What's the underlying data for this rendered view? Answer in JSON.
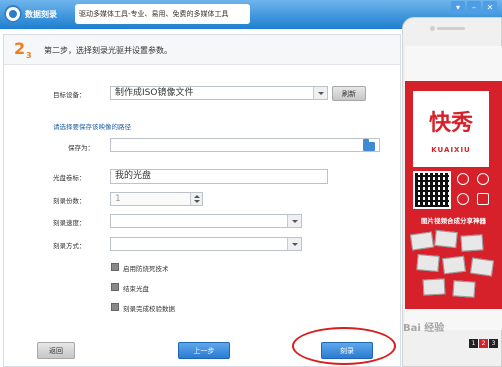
{
  "app": {
    "title": "数据刻录",
    "slogan": "驱动多媒体工具-专业、易用、免费的多媒体工具"
  },
  "window_controls": [
    "▾",
    "–",
    "✕"
  ],
  "step": {
    "number": "2",
    "total": "3",
    "title": "第二步，选择刻录光驱并设置参数。"
  },
  "form": {
    "target_device": {
      "label": "目标设备：",
      "value": "制作成ISO镜像文件",
      "refresh_label": "刷新"
    },
    "save_path_hint": "请选择要保存该映像的路径",
    "save_as": {
      "label": "保存为：",
      "value": ""
    },
    "disc_label": {
      "label": "光盘卷标：",
      "value": "我的光盘"
    },
    "copies": {
      "label": "刻录份数：",
      "value": "1"
    },
    "speed": {
      "label": "刻录速度：",
      "value": ""
    },
    "mode": {
      "label": "刻录方式：",
      "value": ""
    },
    "options": [
      {
        "label": "启用防烧死技术",
        "checked": true
      },
      {
        "label": "结束光盘",
        "checked": true
      },
      {
        "label": "刻录完成校验数据",
        "checked": true
      }
    ]
  },
  "footer": {
    "back_label": "返回",
    "prev_label": "上一步",
    "burn_label": "刻录"
  },
  "ad": {
    "logo_text": "快秀",
    "logo_sub": "KUAIXIU",
    "banner": "图片视频合成分享神器",
    "pages": [
      "1",
      "2",
      "3"
    ]
  },
  "watermark": "Bai 经验",
  "colors": {
    "title_bar": "#1d7fd0",
    "step_accent": "#f07c1a",
    "primary_button": "#2c7bd2",
    "highlight_ring": "#d81e1e",
    "ad_red": "#d6212a"
  }
}
